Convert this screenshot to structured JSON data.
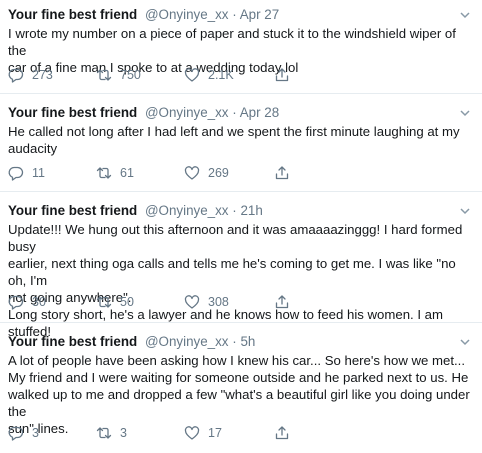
{
  "tweets": [
    {
      "name": "Your fine best friend",
      "handle": "@Onyinye_xx",
      "separator": "·",
      "time": "Apr 27",
      "text": "I wrote my number on a piece of paper and stuck it to the windshield wiper of the\ncar of a fine man I spoke to at a wedding today lol",
      "replies": "273",
      "retweets": "750",
      "likes": "2.1K"
    },
    {
      "name": "Your fine best friend",
      "handle": "@Onyinye_xx",
      "separator": "·",
      "time": "Apr 28",
      "text": "He called not long after I had left and we spent the first minute laughing at my\naudacity",
      "replies": "11",
      "retweets": "61",
      "likes": "269"
    },
    {
      "name": "Your fine best friend",
      "handle": "@Onyinye_xx",
      "separator": "·",
      "time": "21h",
      "text": "Update!!! We hung out this afternoon and it was amaaaazinggg! I hard formed busy\nearlier, next thing oga calls and tells me he's coming to get me. I was like \"no oh, I'm\nnot going anywhere\".\nLong story short, he's a lawyer and he knows how to feed his women. I am stuffed!",
      "replies": "30",
      "retweets": "50",
      "likes": "308"
    },
    {
      "name": "Your fine best friend",
      "handle": "@Onyinye_xx",
      "separator": "·",
      "time": "5h",
      "text": "A lot of people have been asking how I knew his car... So here's how we met...\nMy friend and I were waiting for someone outside and he parked next to us. He\nwalked up to me and dropped a few \"what's a beautiful girl like you doing under the\nsun\" lines.",
      "replies": "3",
      "retweets": "3",
      "likes": "17"
    }
  ],
  "icons": {
    "reply": "reply-icon",
    "retweet": "retweet-icon",
    "like": "heart-icon",
    "share": "share-icon",
    "caret": "chevron-down-icon"
  },
  "colors": {
    "text": "#14171a",
    "secondary": "#657786",
    "divider": "#e6ecf0"
  }
}
